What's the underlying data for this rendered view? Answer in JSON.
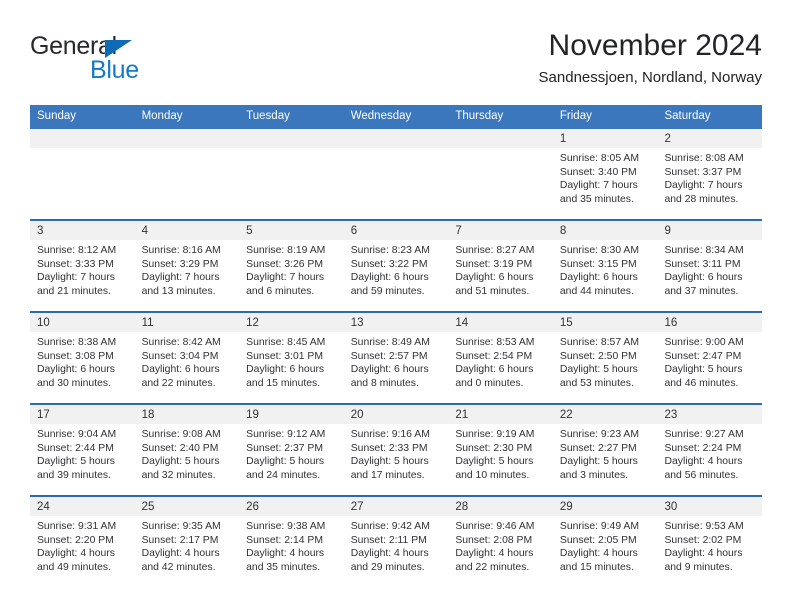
{
  "brand": {
    "name_top": "General",
    "name_bottom": "Blue",
    "triangle_color": "#0d6cb5",
    "blue_text_color": "#1779c6"
  },
  "header": {
    "title": "November 2024",
    "subtitle": "Sandnessjoen, Nordland, Norway"
  },
  "theme": {
    "header_blue": "#3b77bc",
    "row_divider_blue": "#2d6ab0",
    "daynum_band_gray": "#f1f1f1"
  },
  "weekdays": [
    "Sunday",
    "Monday",
    "Tuesday",
    "Wednesday",
    "Thursday",
    "Friday",
    "Saturday"
  ],
  "weeks": [
    [
      {
        "day": "",
        "sunrise": "",
        "sunset": "",
        "daylight": "",
        "empty": true
      },
      {
        "day": "",
        "sunrise": "",
        "sunset": "",
        "daylight": "",
        "empty": true
      },
      {
        "day": "",
        "sunrise": "",
        "sunset": "",
        "daylight": "",
        "empty": true
      },
      {
        "day": "",
        "sunrise": "",
        "sunset": "",
        "daylight": "",
        "empty": true
      },
      {
        "day": "",
        "sunrise": "",
        "sunset": "",
        "daylight": "",
        "empty": true
      },
      {
        "day": "1",
        "sunrise": "Sunrise: 8:05 AM",
        "sunset": "Sunset: 3:40 PM",
        "daylight": "Daylight: 7 hours and 35 minutes."
      },
      {
        "day": "2",
        "sunrise": "Sunrise: 8:08 AM",
        "sunset": "Sunset: 3:37 PM",
        "daylight": "Daylight: 7 hours and 28 minutes."
      }
    ],
    [
      {
        "day": "3",
        "sunrise": "Sunrise: 8:12 AM",
        "sunset": "Sunset: 3:33 PM",
        "daylight": "Daylight: 7 hours and 21 minutes."
      },
      {
        "day": "4",
        "sunrise": "Sunrise: 8:16 AM",
        "sunset": "Sunset: 3:29 PM",
        "daylight": "Daylight: 7 hours and 13 minutes."
      },
      {
        "day": "5",
        "sunrise": "Sunrise: 8:19 AM",
        "sunset": "Sunset: 3:26 PM",
        "daylight": "Daylight: 7 hours and 6 minutes."
      },
      {
        "day": "6",
        "sunrise": "Sunrise: 8:23 AM",
        "sunset": "Sunset: 3:22 PM",
        "daylight": "Daylight: 6 hours and 59 minutes."
      },
      {
        "day": "7",
        "sunrise": "Sunrise: 8:27 AM",
        "sunset": "Sunset: 3:19 PM",
        "daylight": "Daylight: 6 hours and 51 minutes."
      },
      {
        "day": "8",
        "sunrise": "Sunrise: 8:30 AM",
        "sunset": "Sunset: 3:15 PM",
        "daylight": "Daylight: 6 hours and 44 minutes."
      },
      {
        "day": "9",
        "sunrise": "Sunrise: 8:34 AM",
        "sunset": "Sunset: 3:11 PM",
        "daylight": "Daylight: 6 hours and 37 minutes."
      }
    ],
    [
      {
        "day": "10",
        "sunrise": "Sunrise: 8:38 AM",
        "sunset": "Sunset: 3:08 PM",
        "daylight": "Daylight: 6 hours and 30 minutes."
      },
      {
        "day": "11",
        "sunrise": "Sunrise: 8:42 AM",
        "sunset": "Sunset: 3:04 PM",
        "daylight": "Daylight: 6 hours and 22 minutes."
      },
      {
        "day": "12",
        "sunrise": "Sunrise: 8:45 AM",
        "sunset": "Sunset: 3:01 PM",
        "daylight": "Daylight: 6 hours and 15 minutes."
      },
      {
        "day": "13",
        "sunrise": "Sunrise: 8:49 AM",
        "sunset": "Sunset: 2:57 PM",
        "daylight": "Daylight: 6 hours and 8 minutes."
      },
      {
        "day": "14",
        "sunrise": "Sunrise: 8:53 AM",
        "sunset": "Sunset: 2:54 PM",
        "daylight": "Daylight: 6 hours and 0 minutes."
      },
      {
        "day": "15",
        "sunrise": "Sunrise: 8:57 AM",
        "sunset": "Sunset: 2:50 PM",
        "daylight": "Daylight: 5 hours and 53 minutes."
      },
      {
        "day": "16",
        "sunrise": "Sunrise: 9:00 AM",
        "sunset": "Sunset: 2:47 PM",
        "daylight": "Daylight: 5 hours and 46 minutes."
      }
    ],
    [
      {
        "day": "17",
        "sunrise": "Sunrise: 9:04 AM",
        "sunset": "Sunset: 2:44 PM",
        "daylight": "Daylight: 5 hours and 39 minutes."
      },
      {
        "day": "18",
        "sunrise": "Sunrise: 9:08 AM",
        "sunset": "Sunset: 2:40 PM",
        "daylight": "Daylight: 5 hours and 32 minutes."
      },
      {
        "day": "19",
        "sunrise": "Sunrise: 9:12 AM",
        "sunset": "Sunset: 2:37 PM",
        "daylight": "Daylight: 5 hours and 24 minutes."
      },
      {
        "day": "20",
        "sunrise": "Sunrise: 9:16 AM",
        "sunset": "Sunset: 2:33 PM",
        "daylight": "Daylight: 5 hours and 17 minutes."
      },
      {
        "day": "21",
        "sunrise": "Sunrise: 9:19 AM",
        "sunset": "Sunset: 2:30 PM",
        "daylight": "Daylight: 5 hours and 10 minutes."
      },
      {
        "day": "22",
        "sunrise": "Sunrise: 9:23 AM",
        "sunset": "Sunset: 2:27 PM",
        "daylight": "Daylight: 5 hours and 3 minutes."
      },
      {
        "day": "23",
        "sunrise": "Sunrise: 9:27 AM",
        "sunset": "Sunset: 2:24 PM",
        "daylight": "Daylight: 4 hours and 56 minutes."
      }
    ],
    [
      {
        "day": "24",
        "sunrise": "Sunrise: 9:31 AM",
        "sunset": "Sunset: 2:20 PM",
        "daylight": "Daylight: 4 hours and 49 minutes."
      },
      {
        "day": "25",
        "sunrise": "Sunrise: 9:35 AM",
        "sunset": "Sunset: 2:17 PM",
        "daylight": "Daylight: 4 hours and 42 minutes."
      },
      {
        "day": "26",
        "sunrise": "Sunrise: 9:38 AM",
        "sunset": "Sunset: 2:14 PM",
        "daylight": "Daylight: 4 hours and 35 minutes."
      },
      {
        "day": "27",
        "sunrise": "Sunrise: 9:42 AM",
        "sunset": "Sunset: 2:11 PM",
        "daylight": "Daylight: 4 hours and 29 minutes."
      },
      {
        "day": "28",
        "sunrise": "Sunrise: 9:46 AM",
        "sunset": "Sunset: 2:08 PM",
        "daylight": "Daylight: 4 hours and 22 minutes."
      },
      {
        "day": "29",
        "sunrise": "Sunrise: 9:49 AM",
        "sunset": "Sunset: 2:05 PM",
        "daylight": "Daylight: 4 hours and 15 minutes."
      },
      {
        "day": "30",
        "sunrise": "Sunrise: 9:53 AM",
        "sunset": "Sunset: 2:02 PM",
        "daylight": "Daylight: 4 hours and 9 minutes."
      }
    ]
  ]
}
